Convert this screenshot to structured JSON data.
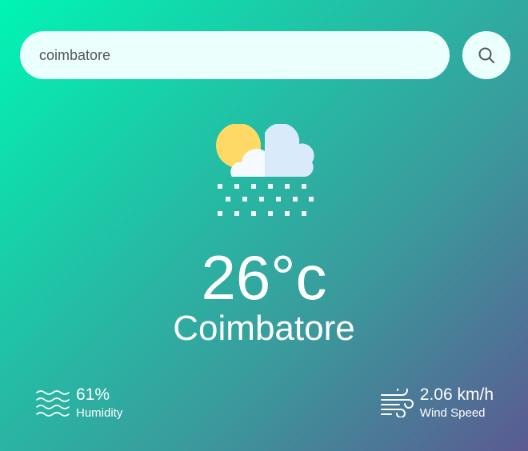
{
  "search": {
    "value": "coimbatore",
    "button_icon": "search-icon"
  },
  "weather": {
    "icon": "snow-sun-cloud-icon",
    "temperature": "26°c",
    "city": "Coimbatore"
  },
  "details": {
    "humidity": {
      "icon": "humidity-waves-icon",
      "value": "61%",
      "label": "Humidity"
    },
    "wind": {
      "icon": "wind-icon",
      "value": "2.06 km/h",
      "label": "Wind Speed"
    }
  },
  "colors": {
    "gradient_start": "#00f5b4",
    "gradient_end": "#5b5a92",
    "search_bg": "#ebfffc",
    "sun": "#ffd966",
    "cloud": "#eef6fb"
  }
}
